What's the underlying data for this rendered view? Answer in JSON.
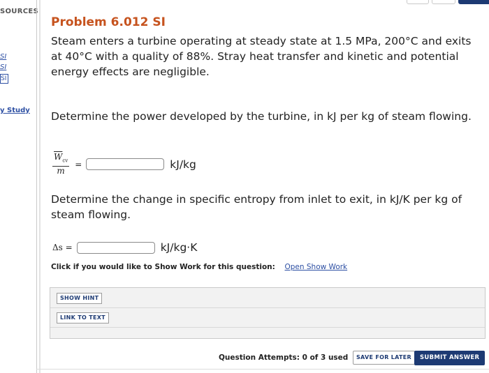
{
  "sidebar": {
    "resources_label": "SOURCES",
    "links": [
      "SI",
      "SI"
    ],
    "box_link": "SI",
    "study_link": "y Study"
  },
  "problem": {
    "title": "Problem 6.012 SI",
    "statement": "Steam enters a turbine operating at steady state at 1.5 MPa, 200°C and exits at 40°C with a quality of 88%. Stray heat transfer and kinetic and potential energy effects are negligible."
  },
  "part1": {
    "question": "Determine the power developed by the turbine, in kJ per kg of steam flowing.",
    "lhs_numerator": "W",
    "lhs_numerator_sub": "cv",
    "lhs_denominator": "m",
    "equals": "=",
    "input_value": "",
    "unit": "kJ/kg"
  },
  "part2": {
    "question": "Determine the change in specific entropy from inlet to exit, in kJ/K per kg of steam flowing.",
    "lhs": "Δs =",
    "input_value": "",
    "unit": "kJ/kg·K"
  },
  "show_work": {
    "prompt": "Click if you would like to Show Work for this question:",
    "link": "Open Show Work"
  },
  "hints": {
    "show_hint": "SHOW HINT",
    "link_to_text": "LINK TO TEXT"
  },
  "footer": {
    "attempts": "Question Attempts: 0 of 3 used",
    "save_label": "SAVE FOR LATER",
    "submit_label": "SUBMIT ANSWER"
  }
}
